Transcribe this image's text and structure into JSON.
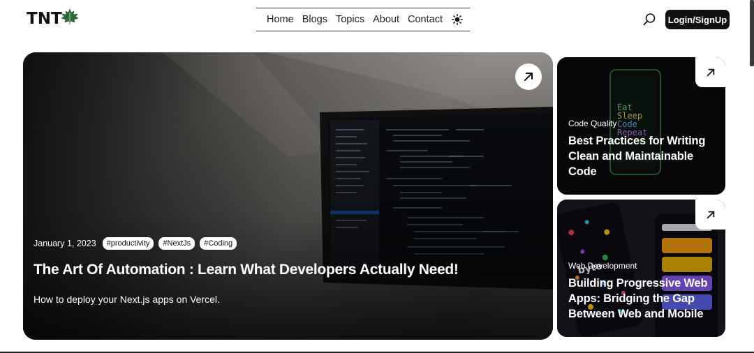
{
  "header": {
    "logo_text": "TNT",
    "logo_icon": "maple-leaf-icon",
    "nav": [
      "Home",
      "Blogs",
      "Topics",
      "About",
      "Contact"
    ],
    "theme_icon": "sun-icon",
    "search_icon": "search-icon",
    "login_label": "Login/SignUp"
  },
  "hero": {
    "date": "January 1, 2023",
    "tags": [
      "#productivity",
      "#NextJs",
      "#Coding"
    ],
    "title": "The Art Of Automation : Learn What Developers Actually Need!",
    "subtitle": "How to deploy your Next.js apps on Vercel.",
    "arrow_icon": "arrow-up-right-icon"
  },
  "side_cards": [
    {
      "category": "Code Quality",
      "title": "Best Practices for Writing Clean and Maintainable Code",
      "arrow_icon": "arrow-up-right-icon"
    },
    {
      "category": "Web Development",
      "title": "Building Progressive Web Apps: Bridging the Gap Between Web and Mobile",
      "arrow_icon": "arrow-up-right-icon"
    }
  ],
  "colors": {
    "accent": "#111111",
    "leaf": "#2e6b3a",
    "background": "#ffffff"
  }
}
